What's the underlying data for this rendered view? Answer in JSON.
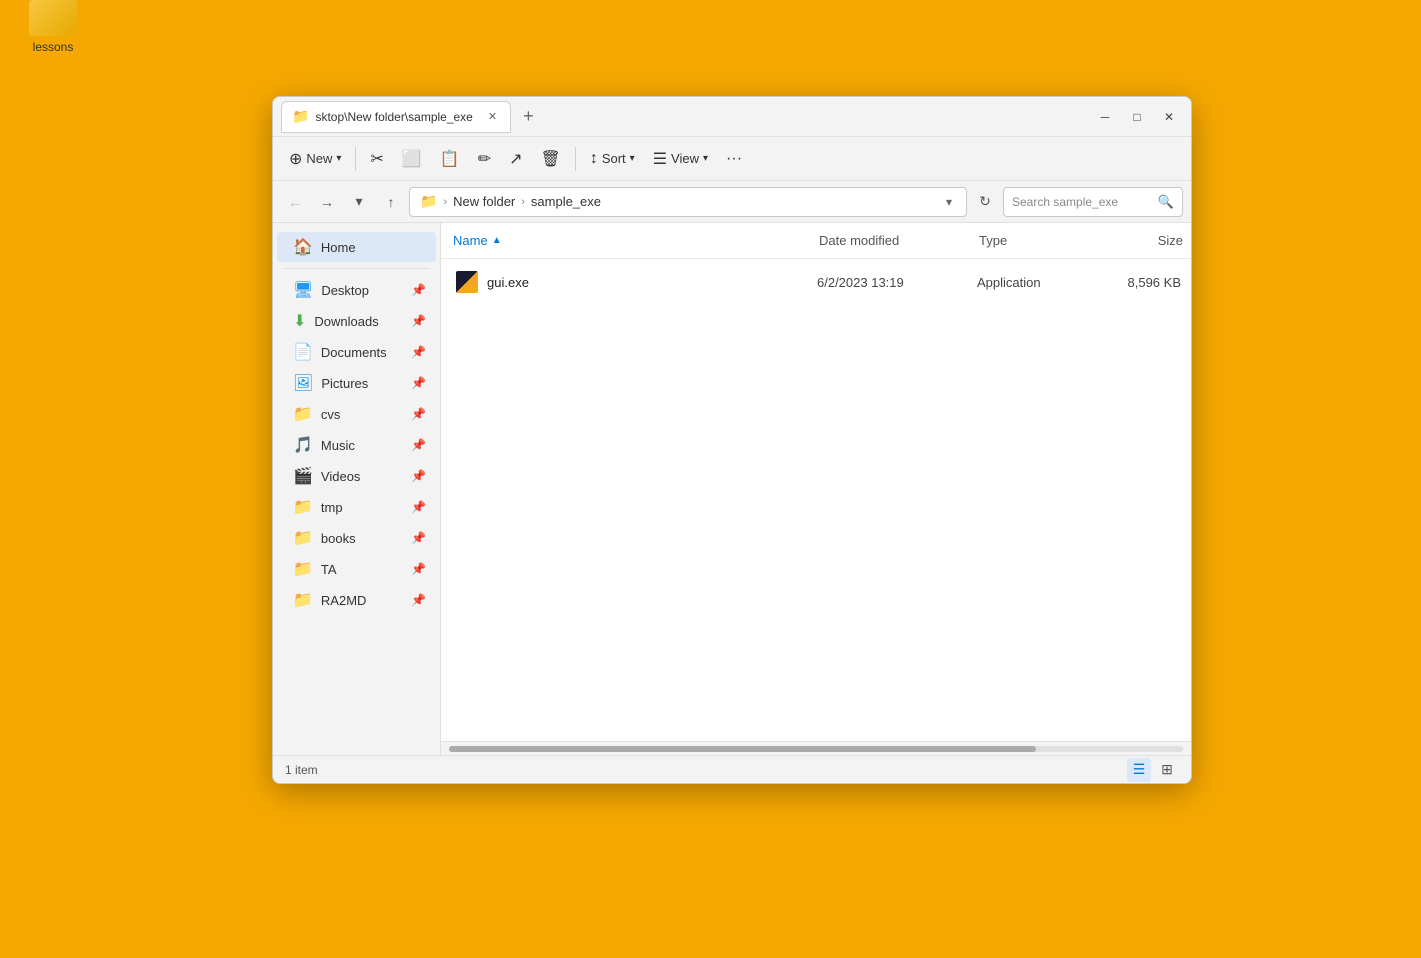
{
  "desktop": {
    "background_color": "#F5A800",
    "icon": {
      "label": "lessons"
    }
  },
  "window": {
    "tab_title": "sktop\\New folder\\sample_exe",
    "title": "sample_exe",
    "breadcrumb": {
      "folder_icon": "📁",
      "parts": [
        "New folder",
        "sample_exe"
      ]
    },
    "search_placeholder": "Search sample_exe",
    "toolbar": {
      "new_label": "New",
      "sort_label": "Sort",
      "view_label": "View",
      "cut_icon": "✂",
      "copy_icon": "⬜",
      "paste_icon": "📋",
      "rename_icon": "✏",
      "share_icon": "↗",
      "delete_icon": "🗑"
    },
    "sidebar": {
      "home_label": "Home",
      "items": [
        {
          "id": "desktop",
          "label": "Desktop",
          "icon": "🖥",
          "color": "#2196F3",
          "pinned": true
        },
        {
          "id": "downloads",
          "label": "Downloads",
          "icon": "⬇",
          "color": "#4CAF50",
          "pinned": true
        },
        {
          "id": "documents",
          "label": "Documents",
          "icon": "📄",
          "color": "#666",
          "pinned": true
        },
        {
          "id": "pictures",
          "label": "Pictures",
          "icon": "🖼",
          "color": "#2196F3",
          "pinned": true
        },
        {
          "id": "cvs",
          "label": "cvs",
          "icon": "📁",
          "color": "#e8a800",
          "pinned": true
        },
        {
          "id": "music",
          "label": "Music",
          "icon": "🎵",
          "color": "#E91E63",
          "pinned": true
        },
        {
          "id": "videos",
          "label": "Videos",
          "icon": "🎬",
          "color": "#9C27B0",
          "pinned": true
        },
        {
          "id": "tmp",
          "label": "tmp",
          "icon": "📁",
          "color": "#e8a800",
          "pinned": true
        },
        {
          "id": "books",
          "label": "books",
          "icon": "📁",
          "color": "#e8a800",
          "pinned": true
        },
        {
          "id": "ta",
          "label": "TA",
          "icon": "📁",
          "color": "#e8a800",
          "pinned": true
        },
        {
          "id": "ra2md",
          "label": "RA2MD",
          "icon": "📁",
          "color": "#e8a800",
          "pinned": true
        }
      ]
    },
    "file_list": {
      "columns": {
        "name": "Name",
        "date_modified": "Date modified",
        "type": "Type",
        "size": "Size"
      },
      "files": [
        {
          "name": "gui.exe",
          "date": "6/2/2023 13:19",
          "type": "Application",
          "size": "8,596 KB"
        }
      ]
    },
    "status": {
      "item_count": "1 item"
    }
  }
}
